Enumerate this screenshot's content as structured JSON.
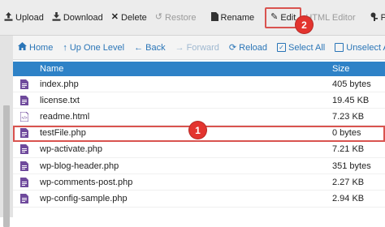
{
  "toolbar": {
    "upload": "Upload",
    "download": "Download",
    "delete": "Delete",
    "restore": "Restore",
    "rename": "Rename",
    "edit": "Edit",
    "html_editor": "HTML Editor",
    "more": "P"
  },
  "callouts": {
    "edit_step": "2",
    "file_step": "1"
  },
  "navbar": {
    "home": "Home",
    "up_one_level": "Up One Level",
    "back": "Back",
    "forward": "Forward",
    "reload": "Reload",
    "select_all": "Select All",
    "unselect_all": "Unselect All"
  },
  "table": {
    "columns": {
      "name": "Name",
      "size": "Size"
    },
    "rows": [
      {
        "name": "index.php",
        "size": "405 bytes",
        "type": "php"
      },
      {
        "name": "license.txt",
        "size": "19.45 KB",
        "type": "txt"
      },
      {
        "name": "readme.html",
        "size": "7.23 KB",
        "type": "html"
      },
      {
        "name": "testFile.php",
        "size": "0 bytes",
        "type": "php"
      },
      {
        "name": "wp-activate.php",
        "size": "7.21 KB",
        "type": "php"
      },
      {
        "name": "wp-blog-header.php",
        "size": "351 bytes",
        "type": "php"
      },
      {
        "name": "wp-comments-post.php",
        "size": "2.27 KB",
        "type": "php"
      },
      {
        "name": "wp-config-sample.php",
        "size": "2.94 KB",
        "type": "php"
      }
    ]
  },
  "colors": {
    "header_blue": "#2e82c7",
    "link_blue": "#2a75b7",
    "file_icon_purple": "#6f4a9c",
    "callout_red": "#e3342f"
  }
}
